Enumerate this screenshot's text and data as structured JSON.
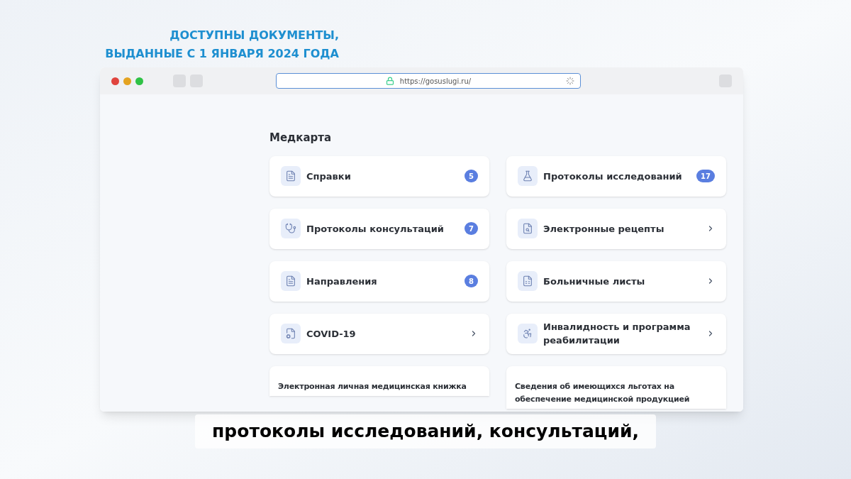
{
  "caption": [
    "ДОСТУПНЫ ДОКУМЕНТЫ,",
    "ВЫДАННЫЕ С 1 ЯНВАРЯ 2024 ГОДА"
  ],
  "browser": {
    "url": "https://gosuslugi.ru/"
  },
  "section": {
    "title": "Медкарта",
    "cards": [
      {
        "kind": "count",
        "label": "Справки",
        "count": "5"
      },
      {
        "kind": "count",
        "label": "Протоколы исследований",
        "count": "17"
      },
      {
        "kind": "count",
        "label": "Протоколы консультаций",
        "count": "7"
      },
      {
        "kind": "link",
        "label": "Электронные рецепты"
      },
      {
        "kind": "count",
        "label": "Направления",
        "count": "8"
      },
      {
        "kind": "link",
        "label": "Больничные листы"
      },
      {
        "kind": "link",
        "label": "COVID-19"
      },
      {
        "kind": "link",
        "label": "Инвалидность и программа реабилитации"
      },
      {
        "kind": "text",
        "label": "Электронная личная медицинская книжка"
      },
      {
        "kind": "text",
        "label": "Сведения об имеющихся льготах на обеспечение медицинской продукцией"
      }
    ]
  },
  "subtitle": "протоколы исследований, консультаций,"
}
